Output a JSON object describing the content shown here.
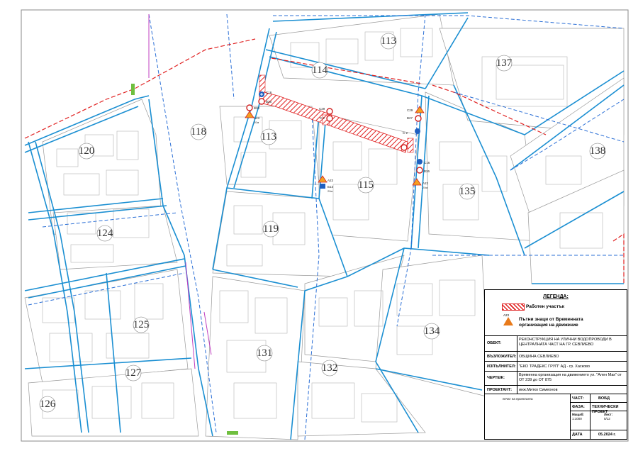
{
  "quarters": [
    {
      "id": "q113a",
      "label": "113"
    },
    {
      "id": "q114",
      "label": "114"
    },
    {
      "id": "q137",
      "label": "137"
    },
    {
      "id": "q118",
      "label": "118"
    },
    {
      "id": "q113b",
      "label": "113"
    },
    {
      "id": "q120",
      "label": "120"
    },
    {
      "id": "q138",
      "label": "138"
    },
    {
      "id": "q115",
      "label": "115"
    },
    {
      "id": "q135",
      "label": "135"
    },
    {
      "id": "q124",
      "label": "124"
    },
    {
      "id": "q119",
      "label": "119"
    },
    {
      "id": "q125",
      "label": "125"
    },
    {
      "id": "q131",
      "label": "131"
    },
    {
      "id": "q134",
      "label": "134"
    },
    {
      "id": "q127",
      "label": "127"
    },
    {
      "id": "q132",
      "label": "132"
    },
    {
      "id": "q126",
      "label": "126"
    }
  ],
  "signs": {
    "a23": "A23",
    "c16": "C16",
    "c29": "C29",
    "b20": "B20",
    "b26": "B26",
    "b27": "B27",
    "b13": "Б13",
    "c2": "C 2",
    "s20": "20м"
  },
  "legend": {
    "title": "ЛЕГЕНДА:",
    "work_zone": "Работен участък",
    "sign_code": "A23",
    "signs_line1": "Пътни знаци от Временната",
    "signs_line2": "организация на движение"
  },
  "title_block": {
    "object_key": "ОБЕКТ:",
    "object_val": "РЕКОНСТРУКЦИЯ НА УЛИЧНИ ВОДОПРОВОДИ В ЦЕНТРАЛНАТА ЧАСТ НА ГР. СЕВЛИЕВО",
    "client_key": "ВЪЗЛОЖИТЕЛ:",
    "client_val": "ОБЩИНА СЕВЛИЕВО",
    "contractor_key": "ИЗПЪЛНИТЕЛ:",
    "contractor_val": "\"ЕКО ТРАДЕКС ГРУП\" АД - гр. Хасково",
    "drawing_key": "ЧЕРТЕЖ:",
    "drawing_val": "Временна организация на движението ул. \"Ален Мак\" от ОТ 239 до ОТ 875",
    "designer_key": "ПРОЕКТАНТ:",
    "designer_val": "инж.Митко Симеонов",
    "stamp_label": "печат на проектанта",
    "part_key": "ЧАСТ:",
    "part_val": "ВОБД",
    "phase_key": "ФАЗА:",
    "phase_val": "ТЕХНИЧЕСКИ ПРОЕКТ",
    "scale_key": "Мащаб:",
    "scale_val": "1:1000",
    "sheet_key": "Лист:",
    "sheet_val": "5/12",
    "date_key": "ДАТА",
    "date_val": "05.2024 г."
  },
  "colors": {
    "street_curb": "#1b8fd2",
    "pipe_dashed": "#2b6fd6",
    "work_zone": "#e02020",
    "sign_warning": "#e87a1a",
    "sign_mandatory": "#1f5fc0"
  }
}
